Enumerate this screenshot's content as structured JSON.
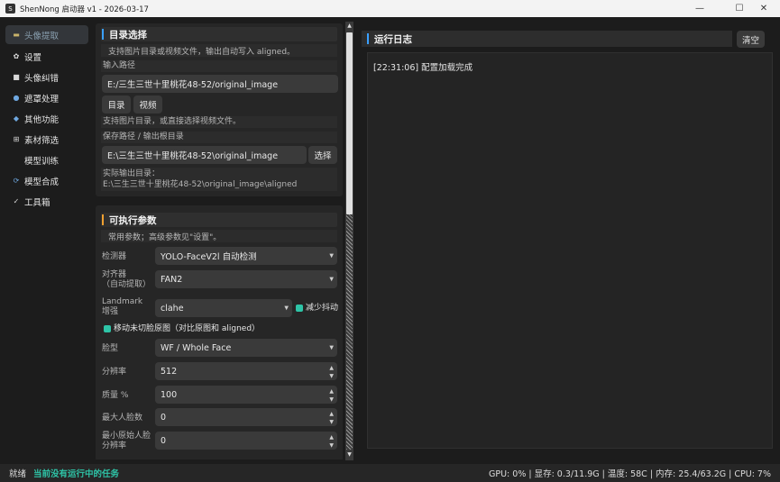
{
  "window": {
    "title": "ShenNong 启动器 v1 - 2026-03-17",
    "app_icon": "S"
  },
  "window_controls": {
    "minimize_glyph": "—",
    "maximize_glyph": "☐",
    "close_glyph": "✕"
  },
  "sidebar": {
    "items": [
      {
        "icon": "folder-icon",
        "glyph": "▬",
        "label": "头像提取"
      },
      {
        "icon": "gear-icon",
        "glyph": "✿",
        "label": "设置"
      },
      {
        "icon": "face-fix-icon",
        "glyph": "■",
        "label": "头像纠错"
      },
      {
        "icon": "mask-icon",
        "glyph": "●",
        "label": "遮罩处理"
      },
      {
        "icon": "tools-icon",
        "glyph": "◆",
        "label": "其他功能"
      },
      {
        "icon": "grid-icon",
        "glyph": "⊞",
        "label": "素材筛选"
      },
      {
        "icon": "",
        "glyph": "",
        "label": "模型训练"
      },
      {
        "icon": "sync-icon",
        "glyph": "⟳",
        "label": "模型合成"
      },
      {
        "icon": "check-icon",
        "glyph": "✓",
        "label": "工具箱"
      }
    ]
  },
  "directory": {
    "title": "目录选择",
    "hint": "支持图片目录或视频文件，输出自动写入 aligned。",
    "input_label": "输入路径",
    "input_value": "E:/三生三世十里桃花48-52/original_image",
    "dir_button": "目录",
    "video_button": "视频",
    "support_hint": "支持图片目录，或直接选择视频文件。",
    "save_label": "保存路径 / 输出根目录",
    "save_value": "E:\\三生三世十里桃花48-52\\original_image",
    "choose_button": "选择",
    "actual_label": "实际输出目录：",
    "actual_value": "E:\\三生三世十里桃花48-52\\original_image\\aligned"
  },
  "params": {
    "title": "可执行参数",
    "hint": "常用参数；高级参数见\"设置\"。",
    "detector_label": "检测器",
    "detector_value": "YOLO-FaceV2l 自动检测",
    "aligner_label": "对齐器\n（自动提取）",
    "aligner_value": "FAN2",
    "landmark_label": "Landmark\n增强",
    "landmark_value": "clahe",
    "reduce_jitter": "减少抖动",
    "move_uncut": "移动未切脸原图（对比原图和 aligned）",
    "face_type_label": "脸型",
    "face_type_value": "WF / Whole Face",
    "resolution_label": "分辨率",
    "resolution_value": "512",
    "quality_label": "质量 %",
    "quality_value": "100",
    "max_faces_label": "最大人脸数",
    "max_faces_value": "0",
    "min_res_label": "最小原始人脸\n分辨率",
    "min_res_value": "0"
  },
  "log": {
    "title": "运行日志",
    "clear_button": "清空",
    "lines": [
      "[22:31:06] 配置加载完成"
    ]
  },
  "status": {
    "state": "就绪",
    "message": "当前没有运行中的任务",
    "metrics": "GPU: 0% | 显存: 0.3/11.9G | 温度: 58C | 内存: 25.4/63.2G | CPU: 7%"
  },
  "colors": {
    "accent": "#2ec4a7",
    "section_bar_blue": "#3aa0ff",
    "section_bar_orange": "#f0a030",
    "status_message": "#2ec4a7"
  }
}
